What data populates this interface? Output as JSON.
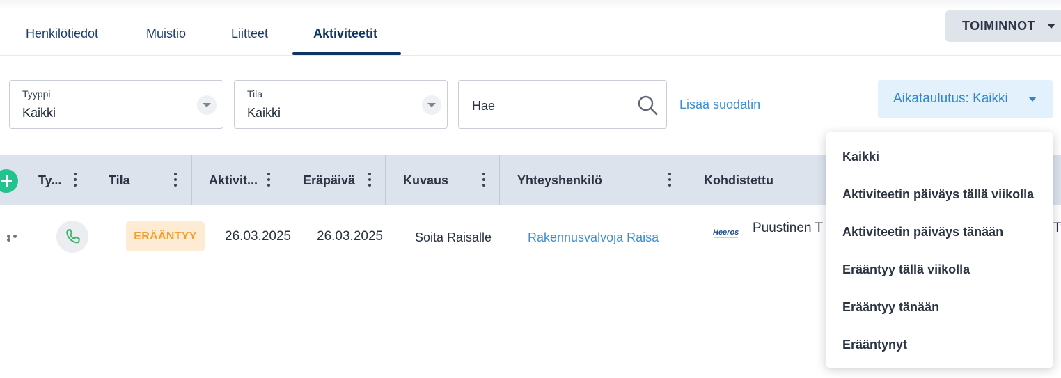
{
  "tabs": [
    {
      "label": "Henkilötiedot"
    },
    {
      "label": "Muistio"
    },
    {
      "label": "Liitteet"
    },
    {
      "label": "Aktiviteetit"
    }
  ],
  "actions_label": "TOIMINNOT",
  "filters": {
    "type": {
      "label": "Tyyppi",
      "value": "Kaikki"
    },
    "status": {
      "label": "Tila",
      "value": "Kaikki"
    },
    "search_placeholder": "Hae",
    "add_filter": "Lisää suodatin",
    "schedule": "Aikataulutus: Kaikki"
  },
  "columns": [
    "Ty...",
    "Tila",
    "Aktivit...",
    "Eräpäivä",
    "Kuvaus",
    "Yhteyshenkilö",
    "Kohdistettu"
  ],
  "rows": [
    {
      "status": "ERÄÄNTYY",
      "activity_date": "26.03.2025",
      "due_date": "26.03.2025",
      "description": "Soita Raisalle",
      "contact": "Rakennusvalvoja Raisa",
      "assigned": "Puustinen T",
      "assigned_tail": "Ty",
      "logo_text": "Heeros"
    }
  ],
  "schedule_menu": [
    "Kaikki",
    "Aktiviteetin päiväys tällä viikolla",
    "Aktiviteetin päiväys tänään",
    "Erääntyy tällä viikolla",
    "Erääntyy tänään",
    "Erääntynyt"
  ],
  "colors": {
    "accent": "#3a8fd6",
    "header_bg": "#dde3ec",
    "status_bg": "#fdebd4",
    "status_text": "#f0a032",
    "add_green": "#22c38e"
  }
}
